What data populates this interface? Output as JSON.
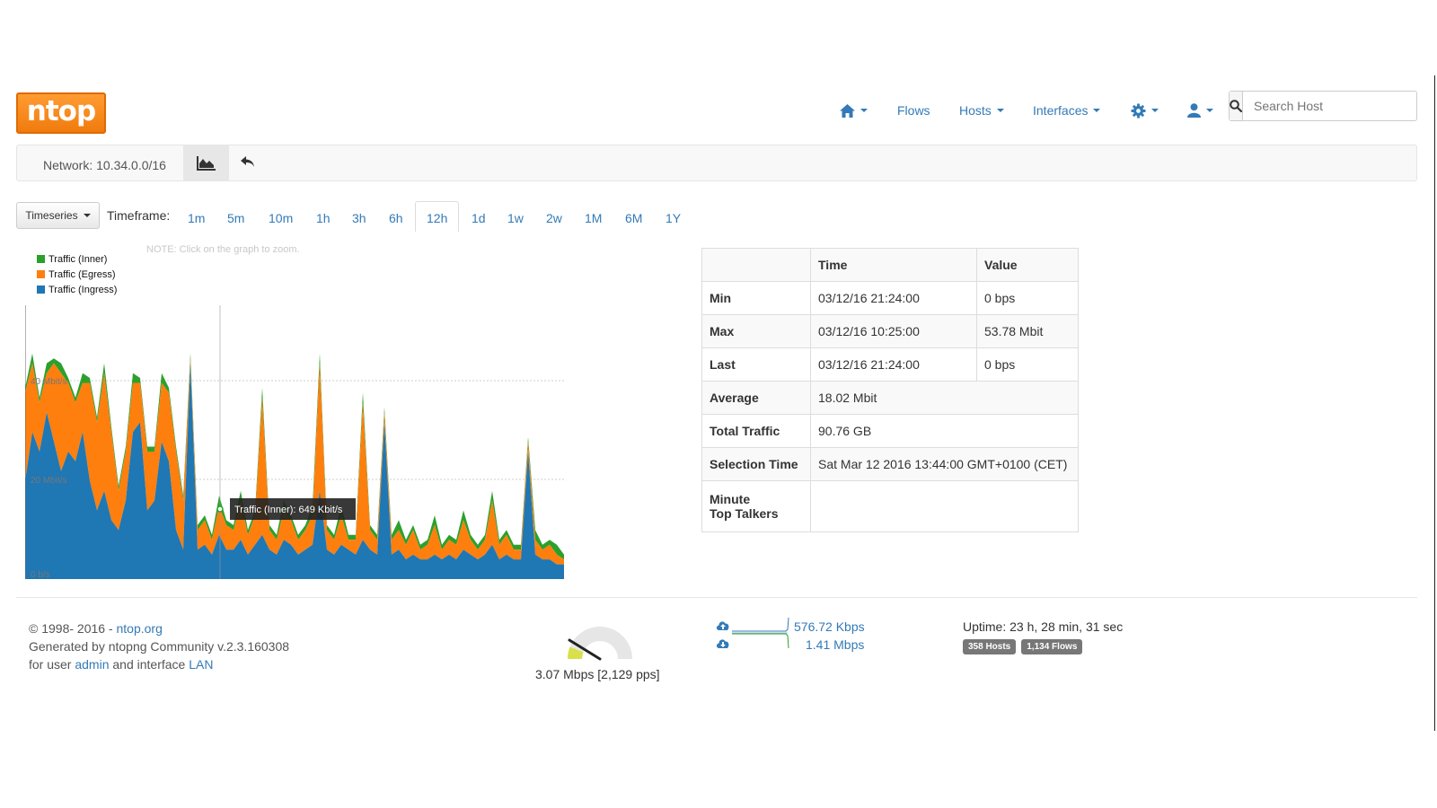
{
  "nav": {
    "logo_text": "ntop",
    "home_icon": "home-icon",
    "flows": "Flows",
    "hosts": "Hosts",
    "interfaces": "Interfaces",
    "settings_icon": "gear-icon",
    "user_icon": "user-icon",
    "search_placeholder": "Search Host"
  },
  "network_bar": {
    "label": "Network: 10.34.0.0/16",
    "chart_icon": "area-chart-icon",
    "back_icon": "reply-icon"
  },
  "controls": {
    "timeseries_label": "Timeseries",
    "timeframe_label": "Timeframe:",
    "timeframes": [
      "1m",
      "5m",
      "10m",
      "1h",
      "3h",
      "6h",
      "12h",
      "1d",
      "1w",
      "2w",
      "1M",
      "6M",
      "1Y"
    ],
    "active_timeframe": "12h"
  },
  "note": "NOTE: Click on the graph to zoom.",
  "legend": [
    {
      "label": "Traffic (Inner)",
      "color": "#2ca02c"
    },
    {
      "label": "Traffic (Egress)",
      "color": "#ff7f0e"
    },
    {
      "label": "Traffic (Ingress)",
      "color": "#1f77b4"
    }
  ],
  "chart_data": {
    "type": "area",
    "stacked": true,
    "y_ticks": [
      "40 Mbit/s",
      "20 Mbit/s",
      "0 b/s"
    ],
    "ylim": [
      0,
      54
    ],
    "tooltip": "Traffic (Inner): 649 Kbit/s",
    "series": [
      {
        "name": "Traffic (Ingress)",
        "color": "#1f77b4",
        "values": [
          20,
          30,
          26,
          34,
          28,
          22,
          26,
          24,
          30,
          20,
          14,
          18,
          12,
          10,
          16,
          30,
          32,
          14,
          16,
          28,
          24,
          10,
          6,
          44,
          6,
          7,
          5,
          9,
          6,
          6,
          8,
          5,
          7,
          9,
          6,
          5,
          8,
          7,
          5,
          6,
          7,
          18,
          6,
          5,
          7,
          6,
          5,
          8,
          6,
          5,
          32,
          5,
          6,
          4,
          5,
          4,
          4,
          5,
          4,
          5,
          4,
          6,
          5,
          4,
          5,
          7,
          4,
          5,
          4,
          4,
          26,
          5,
          4,
          4,
          3,
          3
        ]
      },
      {
        "name": "Traffic (Egress)",
        "color": "#ff7f0e",
        "values": [
          18,
          14,
          10,
          8,
          16,
          20,
          14,
          12,
          10,
          20,
          18,
          24,
          18,
          8,
          10,
          10,
          8,
          12,
          10,
          12,
          14,
          16,
          10,
          1,
          4,
          5,
          3,
          6,
          5,
          4,
          8,
          4,
          6,
          28,
          4,
          3,
          6,
          5,
          3,
          4,
          6,
          26,
          4,
          3,
          6,
          2,
          3,
          28,
          4,
          3,
          2,
          3,
          4,
          3,
          5,
          2,
          3,
          6,
          2,
          3,
          3,
          6,
          3,
          2,
          3,
          9,
          3,
          4,
          2,
          2,
          2,
          3,
          2,
          3,
          2,
          1
        ]
      },
      {
        "name": "Traffic (Inner)",
        "color": "#2ca02c",
        "values": [
          1,
          2,
          1,
          2,
          1,
          2,
          1,
          1,
          2,
          1,
          1,
          2,
          1,
          1,
          1,
          2,
          1,
          1,
          1,
          2,
          1,
          1,
          1,
          1,
          1,
          1,
          1,
          2,
          1,
          1,
          2,
          1,
          1,
          2,
          1,
          1,
          2,
          1,
          1,
          1,
          2,
          2,
          1,
          1,
          2,
          1,
          1,
          2,
          1,
          1,
          1,
          1,
          2,
          1,
          1,
          1,
          1,
          2,
          1,
          1,
          1,
          2,
          1,
          1,
          1,
          2,
          1,
          1,
          1,
          1,
          1,
          2,
          1,
          1,
          2,
          1
        ]
      }
    ]
  },
  "stats": {
    "col_time": "Time",
    "col_value": "Value",
    "min": {
      "label": "Min",
      "time": "03/12/16 21:24:00",
      "value": "0 bps"
    },
    "max": {
      "label": "Max",
      "time": "03/12/16 10:25:00",
      "value": "53.78 Mbit"
    },
    "last": {
      "label": "Last",
      "time": "03/12/16 21:24:00",
      "value": "0 bps"
    },
    "average": {
      "label": "Average",
      "value": "18.02 Mbit"
    },
    "total": {
      "label": "Total Traffic",
      "value": "90.76 GB"
    },
    "selection": {
      "label": "Selection Time",
      "value": "Sat Mar 12 2016 13:44:00 GMT+0100 (CET)"
    },
    "talkers": {
      "label_line1": "Minute",
      "label_line2": "Top Talkers",
      "value": ""
    }
  },
  "footer": {
    "copyright_prefix": "© 1998- 2016 - ",
    "copyright_link": "ntop.org",
    "generated": "Generated by ntopng Community v.2.3.160308",
    "for_user_prefix": "for user ",
    "user": "admin",
    "and_interface": " and interface ",
    "interface": "LAN",
    "gauge_text": "3.07 Mbps [2,129 pps]",
    "gauge_fraction": 0.08,
    "upload_rate": "576.72 Kbps",
    "download_rate": "1.41 Mbps",
    "uptime": "Uptime: 23 h, 28 min, 31 sec",
    "hosts_badge": "358 Hosts",
    "flows_badge": "1,134 Flows"
  }
}
